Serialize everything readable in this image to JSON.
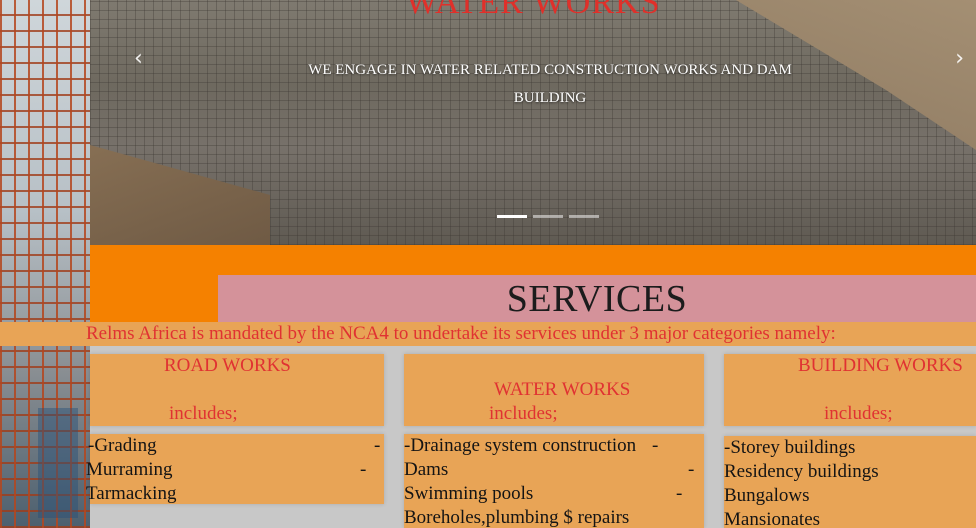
{
  "carousel": {
    "title": "WATER WORKS",
    "caption_line1": "WE ENGAGE IN WATER RELATED CONSTRUCTION WORKS AND DAM",
    "caption_line2": "BUILDING",
    "prev_arrow": "‹",
    "next_arrow": "›",
    "slide_count": 3,
    "active_slide": 1
  },
  "services": {
    "title": "SERVICES",
    "intro": "Relms Africa is mandated by the NCA4 to undertake its services under 3 major categories namely:"
  },
  "categories": [
    {
      "title": "ROAD WORKS",
      "includes": "includes;",
      "items": [
        "-Grading",
        "Murraming",
        "Tarmacking"
      ],
      "dash": "-"
    },
    {
      "title": "WATER WORKS",
      "includes": "includes;",
      "items": [
        "-Drainage system construction",
        "Dams",
        "Swimming pools",
        "Boreholes,plumbing $ repairs"
      ],
      "dash": "-"
    },
    {
      "title": "BUILDING WORKS",
      "includes": "includes;",
      "items": [
        "-Storey buildings",
        "Residency buildings",
        "Bungalows",
        "Mansionates"
      ]
    }
  ],
  "colors": {
    "accent_red": "#e03232",
    "orange_band": "#f58100",
    "card_bg": "#e8a456",
    "services_header_bg": "#d4929a"
  }
}
